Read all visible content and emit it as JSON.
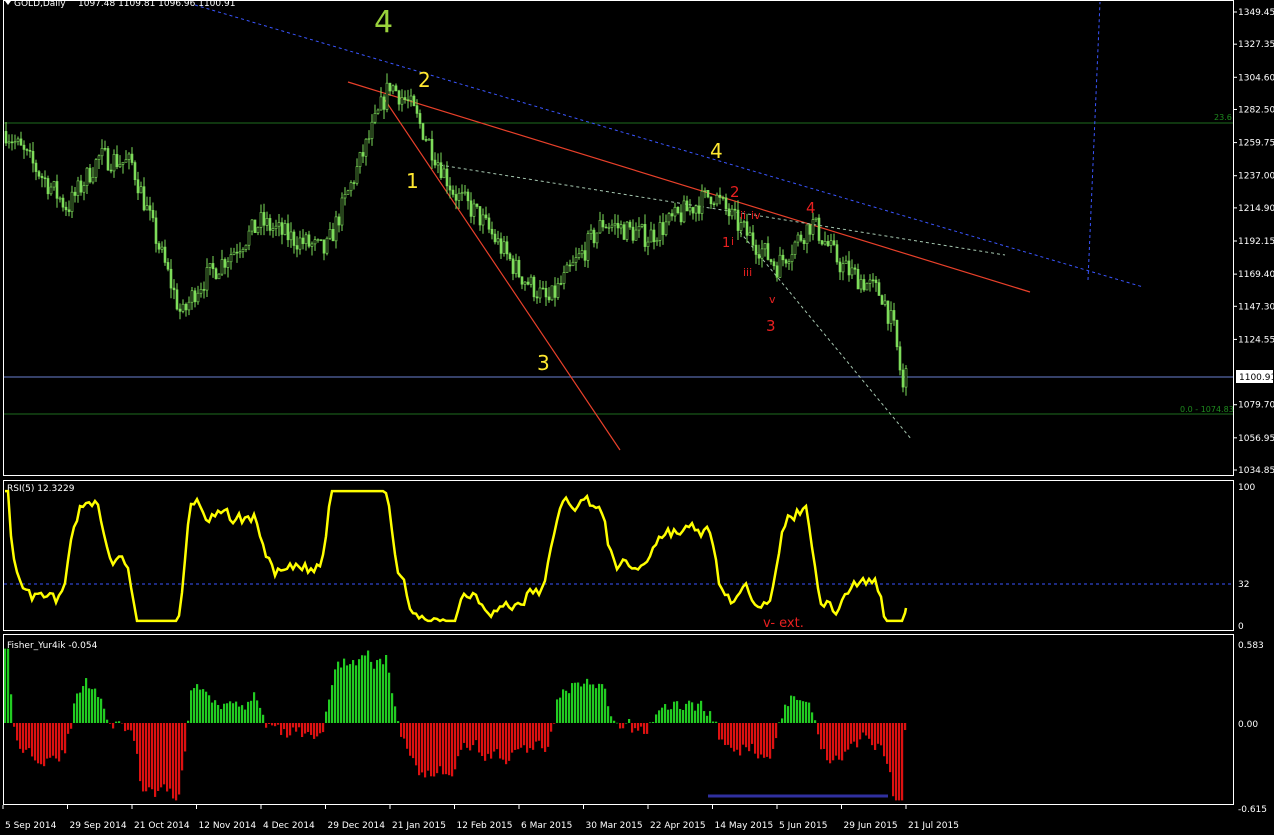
{
  "header": {
    "symbol": "GOLD,Daily",
    "ohlc": "1097.48 1109.81 1096.96 1100.91"
  },
  "colors": {
    "background": "#000000",
    "grid_line": "#ffffff",
    "candles": "#7ddc5a",
    "rsi_line": "#ffff00",
    "fisher_pos": "#22cc22",
    "fisher_neg": "#dd1111",
    "blue_dotted": "#3a55ff",
    "red_line": "#e8402a",
    "fib_line": "#1e6b1e",
    "wave_yellow": "#ffe830",
    "wave_red": "#e82020",
    "wave_green_big": "#9ad23c"
  },
  "price_axis": {
    "ticks": [
      "1349.45",
      "1327.35",
      "1304.60",
      "1282.50",
      "1259.75",
      "1237.00",
      "1214.90",
      "1192.15",
      "1169.40",
      "1147.30",
      "1124.55",
      "1100.91",
      "1079.70",
      "1056.95",
      "1034.85"
    ],
    "current_price": "1100.91"
  },
  "fib_labels": {
    "top": "23.6",
    "bottom": "0.0 - 1074.83"
  },
  "wave_labels": {
    "big4": "4",
    "y2": "2",
    "y1": "1",
    "y3": "3",
    "y4": "4",
    "r2": "2",
    "r4": "4",
    "r1": "1",
    "r3": "3",
    "ri": "i",
    "rii": "ii",
    "riv": "iv",
    "riii": "iii",
    "rv": "v"
  },
  "rsi": {
    "title": "RSI(5) 12.3229",
    "axis": [
      "100",
      "32",
      "0"
    ],
    "annotation": "v- ext."
  },
  "fisher": {
    "title": "Fisher_Yur4ik -0.054",
    "axis": [
      "0.583",
      "0.00",
      "-0.615"
    ]
  },
  "date_axis": [
    "5 Sep 2014",
    "29 Sep 2014",
    "21 Oct 2014",
    "12 Nov 2014",
    "4 Dec 2014",
    "29 Dec 2014",
    "21 Jan 2015",
    "12 Feb 2015",
    "6 Mar 2015",
    "30 Mar 2015",
    "22 Apr 2015",
    "14 May 2015",
    "5 Jun 2015",
    "29 Jun 2015",
    "21 Jul 2015"
  ],
  "chart_data": {
    "type": "line",
    "title": "GOLD,Daily",
    "price_range": [
      1034.85,
      1349.45
    ],
    "rsi_range": [
      0,
      100
    ],
    "fisher_range": [
      -0.615,
      0.583
    ],
    "anchors": [
      {
        "date": "5 Sep 2014",
        "close": 1270
      },
      {
        "date": "29 Sep 2014",
        "close": 1215
      },
      {
        "date": "10 Oct 2014",
        "close": 1250
      },
      {
        "date": "21 Oct 2014",
        "close": 1245
      },
      {
        "date": "7 Nov 2014",
        "close": 1140
      },
      {
        "date": "12 Nov 2014",
        "close": 1160
      },
      {
        "date": "4 Dec 2014",
        "close": 1205
      },
      {
        "date": "15 Dec 2014",
        "close": 1195
      },
      {
        "date": "29 Dec 2014",
        "close": 1185
      },
      {
        "date": "21 Jan 2015",
        "close": 1300
      },
      {
        "date": "28 Jan 2015",
        "close": 1285
      },
      {
        "date": "12 Feb 2015",
        "close": 1225
      },
      {
        "date": "20 Feb 2015",
        "close": 1210
      },
      {
        "date": "6 Mar 2015",
        "close": 1170
      },
      {
        "date": "17 Mar 2015",
        "close": 1150
      },
      {
        "date": "30 Mar 2015",
        "close": 1185
      },
      {
        "date": "6 Apr 2015",
        "close": 1205
      },
      {
        "date": "22 Apr 2015",
        "close": 1195
      },
      {
        "date": "14 May 2015",
        "close": 1225
      },
      {
        "date": "22 May 2015",
        "close": 1205
      },
      {
        "date": "5 Jun 2015",
        "close": 1175
      },
      {
        "date": "18 Jun 2015",
        "close": 1205
      },
      {
        "date": "29 Jun 2015",
        "close": 1175
      },
      {
        "date": "13 Jul 2015",
        "close": 1155
      },
      {
        "date": "17 Jul 2015",
        "close": 1130
      },
      {
        "date": "20 Jul 2015",
        "close": 1090
      },
      {
        "date": "21 Jul 2015",
        "close": 1100.91
      }
    ],
    "rsi_last": 12.3229,
    "rsi_level": 32,
    "fisher_last": -0.054
  }
}
